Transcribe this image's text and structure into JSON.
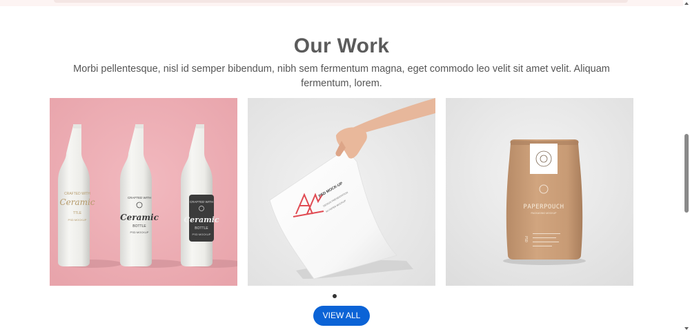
{
  "section": {
    "title": "Our Work",
    "subtitle": "Morbi pellentesque, nisl id semper bibendum, nibh sem fermentum magna, eget commodo leo velit sit amet velit. Aliquam fermentum, lorem.",
    "view_all_label": "VIEW ALL"
  },
  "gallery": {
    "items": [
      {
        "background_color": "#eeb0b6",
        "bottle_labels": {
          "left": "Ceramic",
          "middle_small": "BOTTLE",
          "middle": "Ceramic",
          "right_small": "BOTTLE",
          "right": "Ceramic"
        }
      },
      {
        "background_color": "#e9e9e9",
        "paper_text": "PSD MOCK-UP"
      },
      {
        "background_color": "#e8e8e8",
        "pouch_brand": "PAPERPOUCH",
        "pouch_side": "PSD"
      }
    ],
    "pagination": {
      "active": 1,
      "count": 1
    }
  },
  "colors": {
    "title": "#5b5b5b",
    "text": "#555555",
    "button": "#0b63d6"
  }
}
